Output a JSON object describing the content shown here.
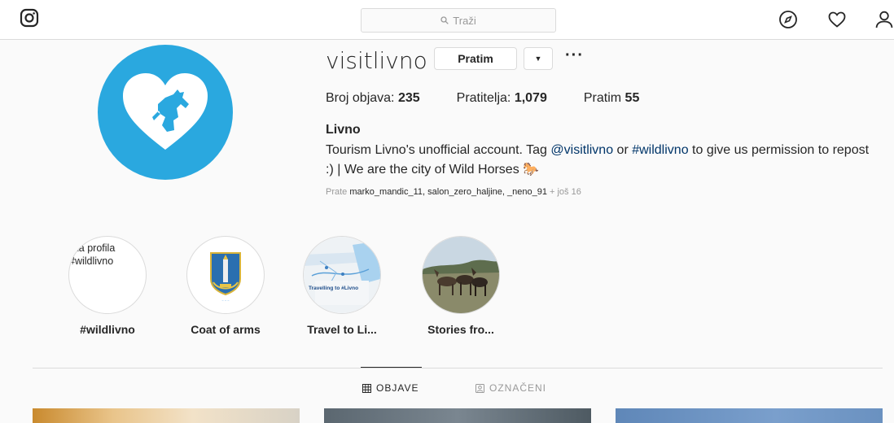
{
  "topbar": {
    "search_placeholder": "Traži"
  },
  "profile": {
    "username": "visitlivno",
    "follow_label": "Pratim",
    "more_label": "···",
    "stats": {
      "posts_label": "Broj objava:",
      "posts_value": "235",
      "followers_label": "Pratitelja:",
      "followers_value": "1,079",
      "following_label": "Pratim",
      "following_value": "55"
    },
    "full_name": "Livno",
    "bio": {
      "text1": "Tourism Livno's unofficial account. Tag ",
      "mention": "@visitlivno",
      "text2": " or ",
      "hashtag": "#wildlivno",
      "text3": " to give us permission to repost :) | We are the city of Wild Horses ",
      "emoji": "🐎"
    },
    "followed_by": {
      "prefix": "Prate",
      "names": "marko_mandic_11, salon_zero_haljine, _neno_91",
      "more": "+ još 16"
    }
  },
  "highlights": [
    {
      "label": "#wildlivno",
      "alt_text": "lika profila #wildlivno"
    },
    {
      "label": "Coat of arms"
    },
    {
      "label": "Travel to Li...",
      "cover_text": "Travelling to #Livno"
    },
    {
      "label": "Stories fro..."
    }
  ],
  "tabs": [
    {
      "label": "OBJAVE"
    },
    {
      "label": "OZNAČENI"
    }
  ],
  "colors": {
    "avatar_bg": "#2aa8df",
    "link": "#003569",
    "border": "#dbdbdb"
  }
}
